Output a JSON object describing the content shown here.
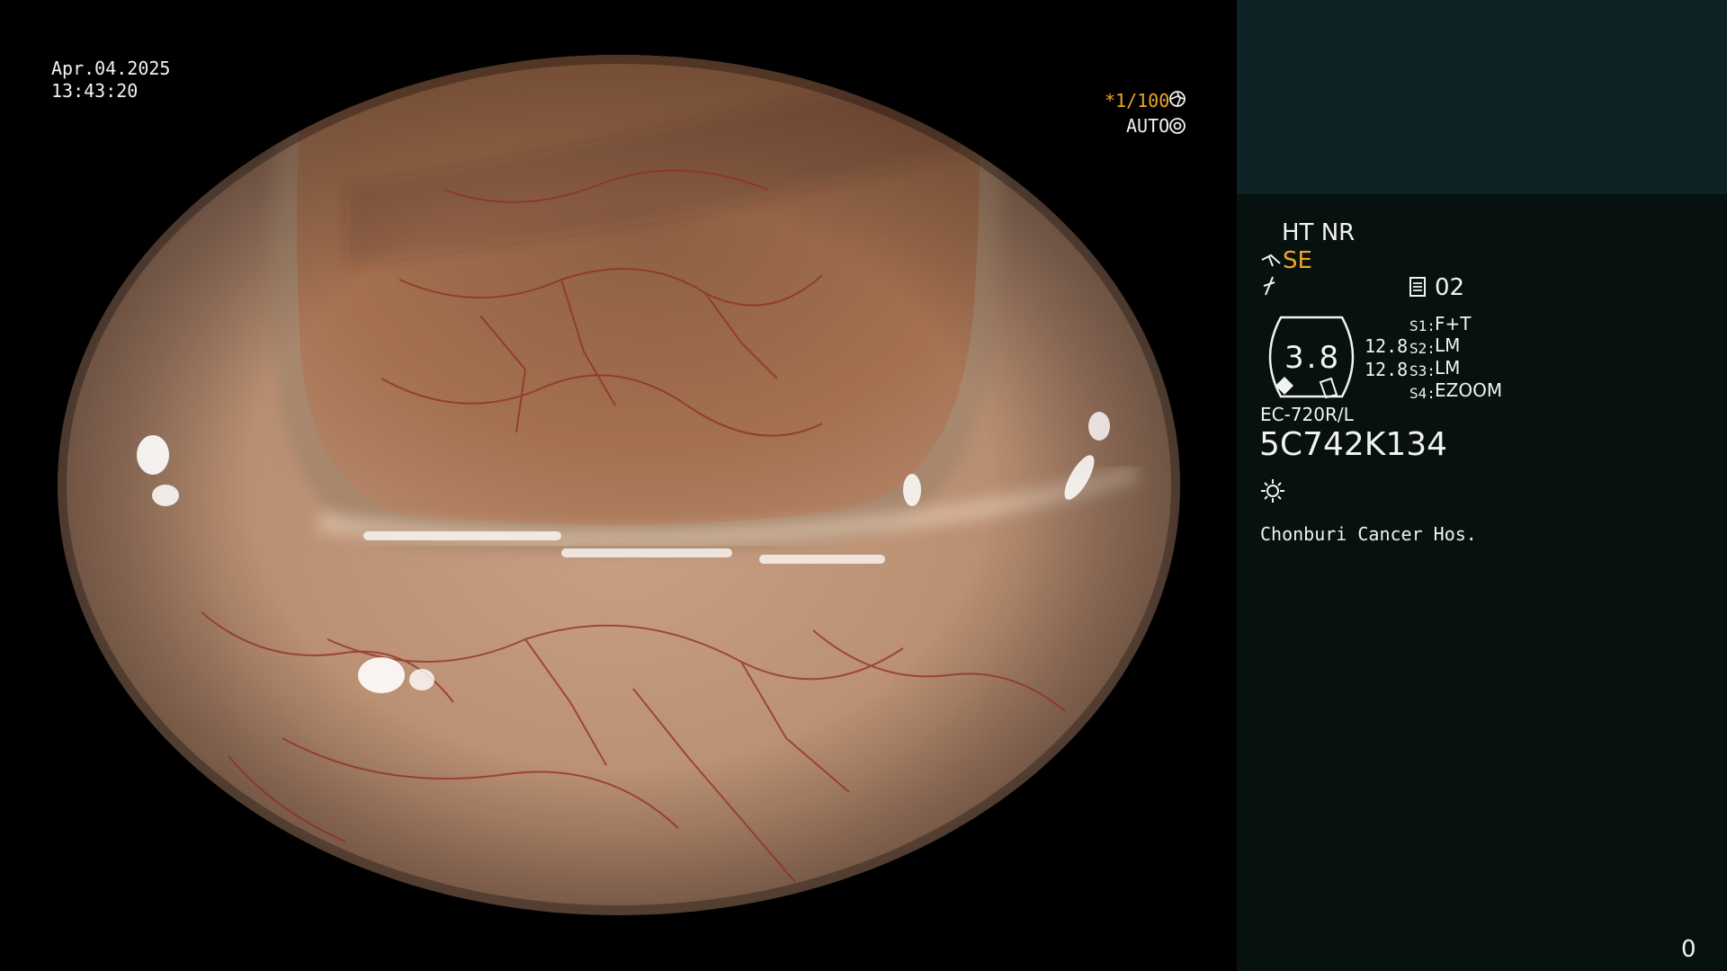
{
  "overlay": {
    "date": "Apr.04.2025",
    "time": "13:43:20",
    "shutter": "*1/100",
    "auto": "AUTO",
    "ht_nr": "HT NR",
    "se": "SE",
    "page_num": "02",
    "gauge_value": "3.8",
    "gauge_num1": "12.8",
    "gauge_num2": "12.8",
    "s1_label": "S1:",
    "s1_value": "F+T",
    "s2_label": "S2:",
    "s2_value": "LM",
    "s3_label": "S3:",
    "s3_value": "LM",
    "s4_label": "S4:",
    "s4_value": "EZOOM",
    "model": "EC-720R/L",
    "serial": "5C742K134",
    "hospital": "Chonburi Cancer Hos.",
    "counter": "0"
  },
  "colors": {
    "accent_orange": "#f0a623",
    "panel_top": "#0d2224",
    "panel_bottom": "#07110f",
    "tissue": "#c79a7b",
    "vessel": "#8f2d24"
  },
  "icons": {
    "shutter": "aperture-icon",
    "auto": "iris-icon",
    "se": "structure-enhance-icon",
    "slash": "color-mode-icon",
    "page": "document-icon",
    "light": "light-icon"
  }
}
